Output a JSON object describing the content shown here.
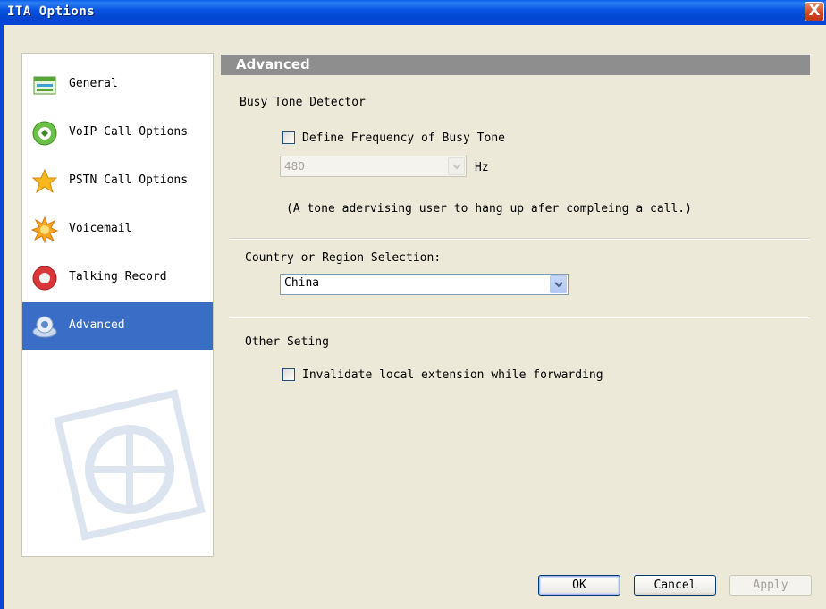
{
  "window": {
    "title": "ITA Options",
    "close_label": "X"
  },
  "sidebar": {
    "items": [
      {
        "label": "General",
        "icon": "general-icon"
      },
      {
        "label": "VoIP Call Options",
        "icon": "voip-icon"
      },
      {
        "label": "PSTN Call Options",
        "icon": "pstn-star-icon"
      },
      {
        "label": "Voicemail",
        "icon": "voicemail-icon"
      },
      {
        "label": "Talking Record",
        "icon": "record-icon"
      },
      {
        "label": "Advanced",
        "icon": "advanced-icon",
        "selected": true
      }
    ]
  },
  "panel": {
    "title": "Advanced",
    "busy_tone": {
      "heading": "Busy Tone Detector",
      "define_checkbox_label": "Define Frequency of Busy Tone",
      "define_checked": false,
      "frequency_value": "480",
      "frequency_unit": "Hz",
      "hint": "(A tone adervising user to hang up afer compleing a call.)"
    },
    "country": {
      "label": "Country or Region Selection:",
      "selected": "China"
    },
    "other": {
      "heading": "Other Seting",
      "invalidate_label": "Invalidate local extension while forwarding",
      "invalidate_checked": false
    }
  },
  "buttons": {
    "ok": "OK",
    "cancel": "Cancel",
    "apply": "Apply"
  },
  "colors": {
    "title_bar": "#0A5FEB",
    "selected_item": "#3A6EC6",
    "panel_header": "#8E8E8E",
    "dialog_bg": "#ECE9D8"
  }
}
